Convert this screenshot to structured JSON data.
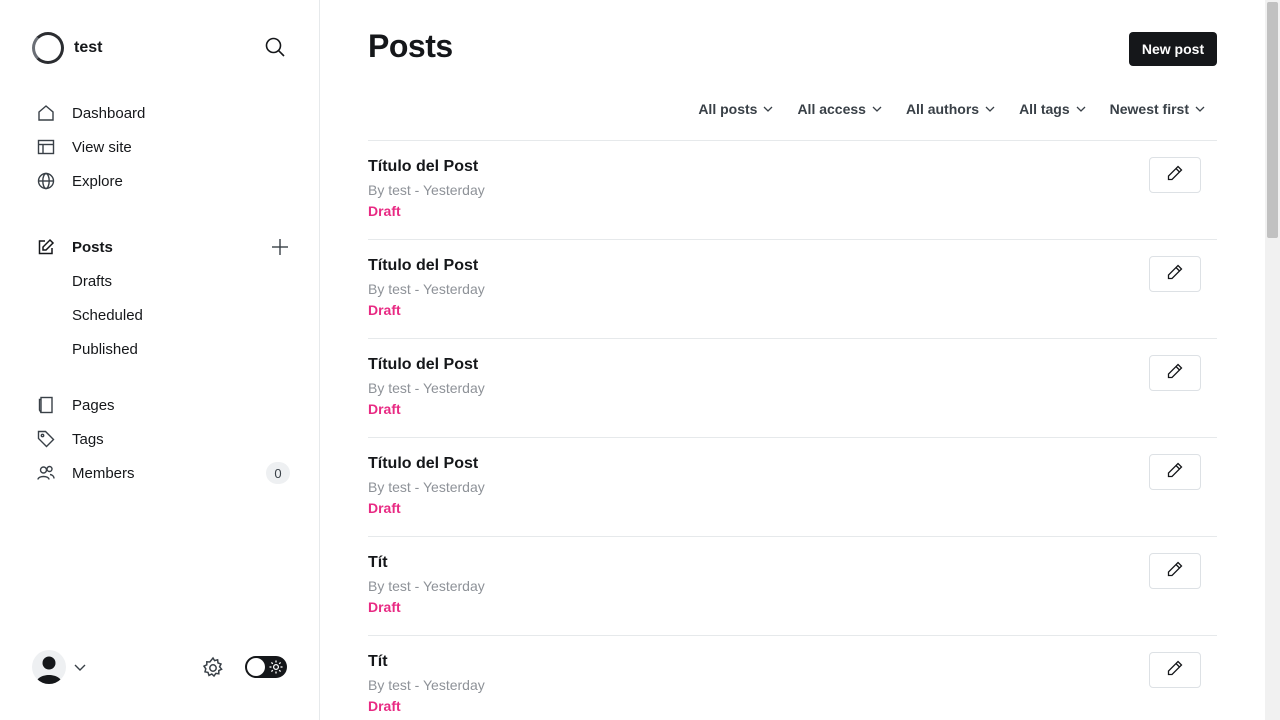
{
  "site": {
    "name": "test"
  },
  "nav": {
    "dashboard": "Dashboard",
    "view_site": "View site",
    "explore": "Explore",
    "posts": "Posts",
    "drafts": "Drafts",
    "scheduled": "Scheduled",
    "published": "Published",
    "pages": "Pages",
    "tags": "Tags",
    "members": "Members",
    "members_count": "0"
  },
  "main": {
    "title": "Posts",
    "new_post_label": "New post",
    "filters": [
      "All posts",
      "All access",
      "All authors",
      "All tags",
      "Newest first"
    ]
  },
  "posts": [
    {
      "title": "Título del Post",
      "meta": "By test - Yesterday",
      "status": "Draft"
    },
    {
      "title": "Título del Post",
      "meta": "By test - Yesterday",
      "status": "Draft"
    },
    {
      "title": "Título del Post",
      "meta": "By test - Yesterday",
      "status": "Draft"
    },
    {
      "title": "Título del Post",
      "meta": "By test - Yesterday",
      "status": "Draft"
    },
    {
      "title": "Tít",
      "meta": "By test - Yesterday",
      "status": "Draft"
    },
    {
      "title": "Tít",
      "meta": "By test - Yesterday",
      "status": "Draft"
    }
  ],
  "colors": {
    "accent": "#15171a",
    "draft": "#e82a83",
    "muted": "#8e9298"
  },
  "icons": {
    "search": "search-icon",
    "dashboard": "home-icon",
    "view_site": "layout-icon",
    "explore": "globe-icon",
    "posts": "edit-icon",
    "pages": "pages-icon",
    "tags": "tag-icon",
    "members": "members-icon",
    "settings": "gear-icon",
    "edit": "pencil-icon"
  }
}
